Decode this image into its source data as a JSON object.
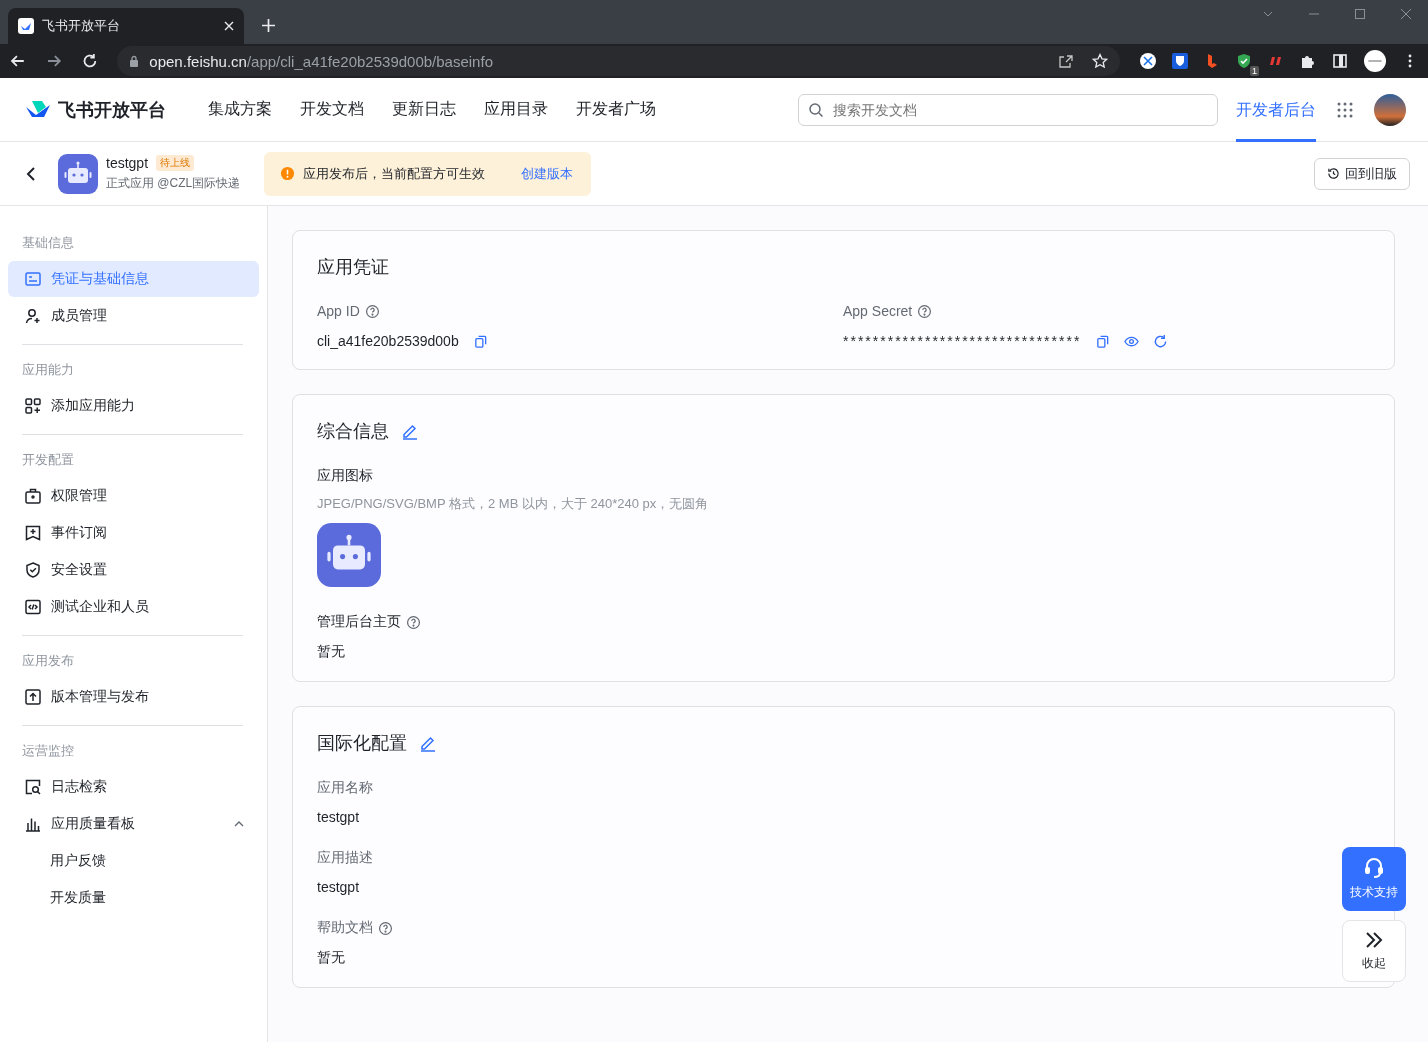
{
  "browser": {
    "tab_title": "飞书开放平台",
    "url_host": "open.feishu.cn",
    "url_path": "/app/cli_a41fe20b2539d00b/baseinfo",
    "extension_badge": "1"
  },
  "nav": {
    "brand": "飞书开放平台",
    "links": [
      "集成方案",
      "开发文档",
      "更新日志",
      "应用目录",
      "开发者广场"
    ],
    "search": {
      "placeholder": "搜索开发文档"
    },
    "console": {
      "label": "开发者后台",
      "selected": true
    }
  },
  "app_header": {
    "name": "testgpt",
    "status": "待上线",
    "subtitle": "正式应用 @CZL国际快递",
    "notice": "应用发布后，当前配置方可生效",
    "notice_link": "创建版本",
    "old_version_button": "回到旧版"
  },
  "sidebar": [
    {
      "title": "基础信息",
      "items": [
        {
          "label": "凭证与基础信息",
          "selected": true
        },
        {
          "label": "成员管理",
          "selected": false
        }
      ]
    },
    {
      "title": "应用能力",
      "items": [
        {
          "label": "添加应用能力",
          "selected": false
        }
      ]
    },
    {
      "title": "开发配置",
      "items": [
        {
          "label": "权限管理",
          "selected": false
        },
        {
          "label": "事件订阅",
          "selected": false
        },
        {
          "label": "安全设置",
          "selected": false
        },
        {
          "label": "测试企业和人员",
          "selected": false
        }
      ]
    },
    {
      "title": "应用发布",
      "items": [
        {
          "label": "版本管理与发布",
          "selected": false
        }
      ]
    },
    {
      "title": "运营监控",
      "items": [
        {
          "label": "日志检索",
          "selected": false
        },
        {
          "label": "应用质量看板",
          "selected": false,
          "expanded": true,
          "children": [
            {
              "label": "用户反馈",
              "selected": false
            },
            {
              "label": "开发质量",
              "selected": false
            }
          ]
        }
      ]
    }
  ],
  "credentials": {
    "title": "应用凭证",
    "app_id": {
      "label": "App ID",
      "value": "cli_a41fe20b2539d00b"
    },
    "app_secret": {
      "label": "App Secret",
      "value": "********************************"
    }
  },
  "general": {
    "title": "综合信息",
    "icon_label": "应用图标",
    "icon_hint": "JPEG/PNG/SVG/BMP 格式，2 MB 以内，大于 240*240 px，无圆角",
    "homepage_label": "管理后台主页",
    "homepage_value": "暂无"
  },
  "i18n": {
    "title": "国际化配置",
    "fields": [
      {
        "label": "应用名称",
        "value": "testgpt",
        "help": false
      },
      {
        "label": "应用描述",
        "value": "testgpt",
        "help": false
      },
      {
        "label": "帮助文档",
        "value": "暂无",
        "help": true
      }
    ]
  },
  "float": {
    "support": "技术支持",
    "collapse": "收起"
  }
}
